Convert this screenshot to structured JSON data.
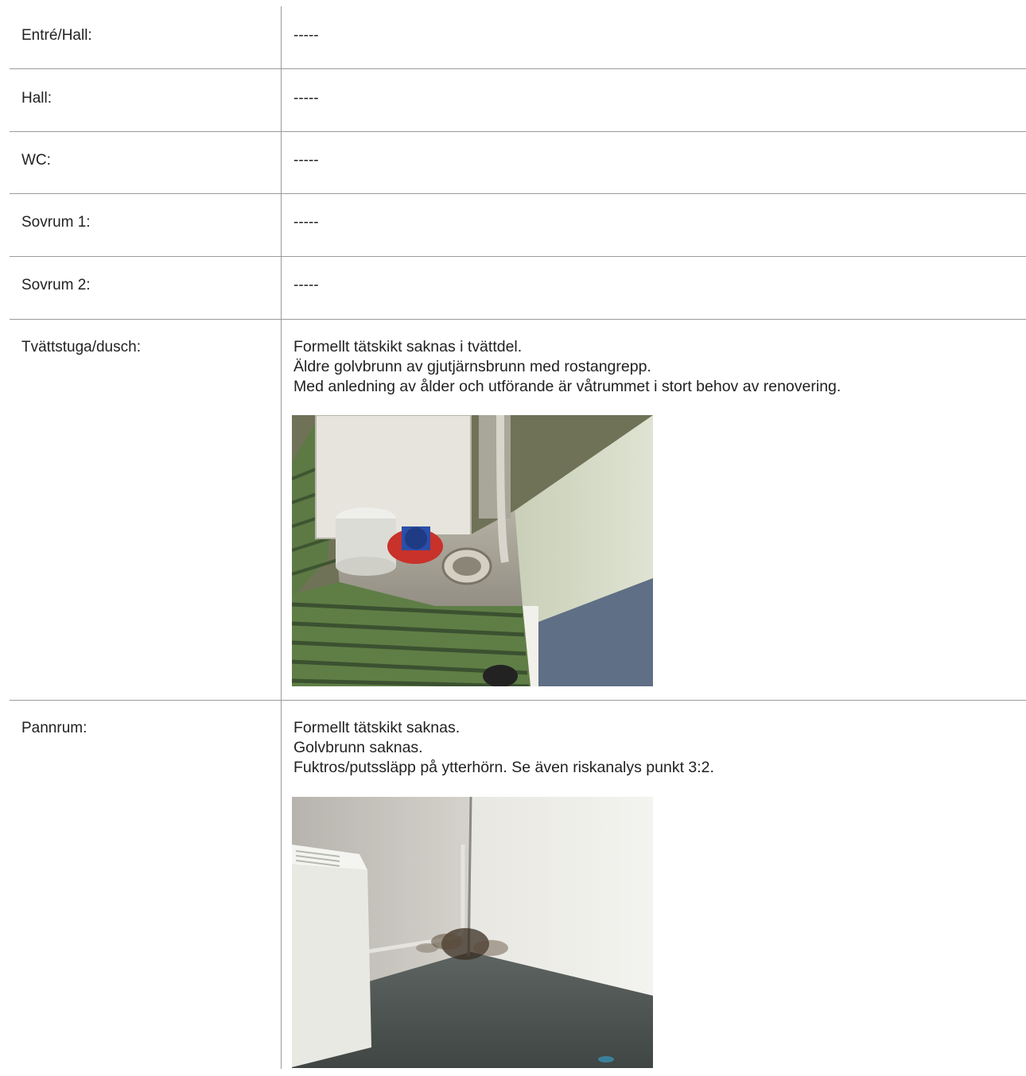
{
  "rows": [
    {
      "label": "Entré/Hall:",
      "value": "-----"
    },
    {
      "label": "Hall:",
      "value": "-----"
    },
    {
      "label": "WC:",
      "value": "-----"
    },
    {
      "label": "Sovrum 1:",
      "value": "-----"
    },
    {
      "label": "Sovrum 2:",
      "value": "-----"
    },
    {
      "label": "Tvättstuga/dusch:",
      "lines": [
        "Formellt tätskikt saknas i tvättdel.",
        "Äldre golvbrunn av gjutjärnsbrunn med rostangrepp.",
        "Med anledning av ålder och utförande är våtrummet i stort behov av renovering."
      ]
    },
    {
      "label": "Pannrum:",
      "lines": [
        "Formellt tätskikt saknas.",
        "Golvbrunn saknas.",
        "Fuktros/putssläpp på ytterhörn. Se även riskanalys punkt 3:2."
      ]
    }
  ]
}
